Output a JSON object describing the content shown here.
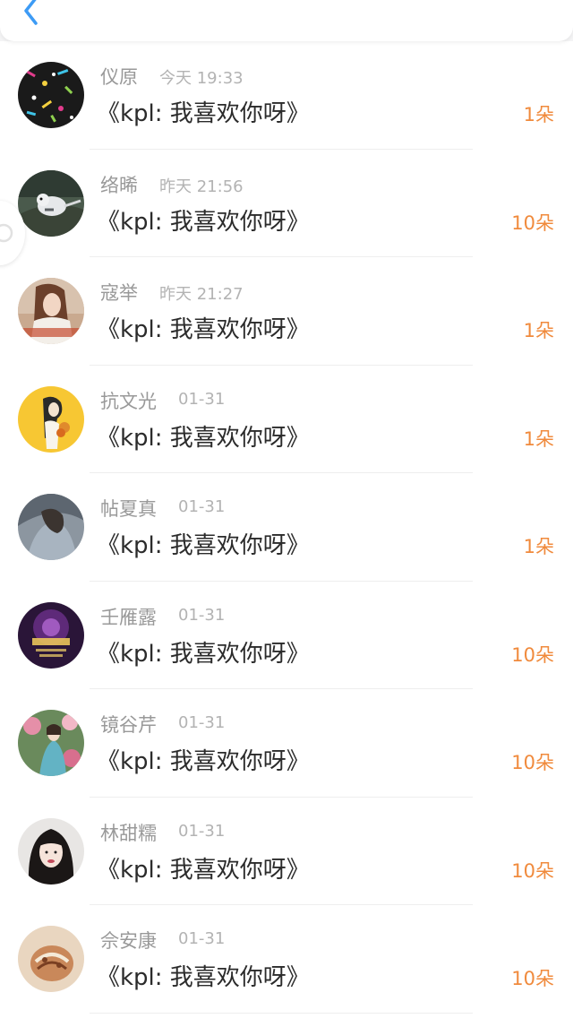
{
  "header": {
    "back_icon": "chevron-left-icon"
  },
  "colors": {
    "accent_blue": "#3d9bf5",
    "amount_orange": "#f08a3c",
    "name_gray": "#999999",
    "title_dark": "#2b2b2b"
  },
  "items": [
    {
      "name": "仪原",
      "time": "今天 19:33",
      "title": "《kpl: 我喜欢你呀》",
      "amount": "1朵"
    },
    {
      "name": "络晞",
      "time": "昨天 21:56",
      "title": "《kpl: 我喜欢你呀》",
      "amount": "10朵"
    },
    {
      "name": "寇举",
      "time": "昨天 21:27",
      "title": "《kpl: 我喜欢你呀》",
      "amount": "1朵"
    },
    {
      "name": "抗文光",
      "time": "01-31",
      "title": "《kpl: 我喜欢你呀》",
      "amount": "1朵"
    },
    {
      "name": "帖夏真",
      "time": "01-31",
      "title": "《kpl: 我喜欢你呀》",
      "amount": "1朵"
    },
    {
      "name": "壬雁露",
      "time": "01-31",
      "title": "《kpl: 我喜欢你呀》",
      "amount": "10朵"
    },
    {
      "name": "镜谷芹",
      "time": "01-31",
      "title": "《kpl: 我喜欢你呀》",
      "amount": "10朵"
    },
    {
      "name": "林甜糯",
      "time": "01-31",
      "title": "《kpl: 我喜欢你呀》",
      "amount": "10朵"
    },
    {
      "name": "佘安康",
      "time": "01-31",
      "title": "《kpl: 我喜欢你呀》",
      "amount": "10朵"
    }
  ]
}
